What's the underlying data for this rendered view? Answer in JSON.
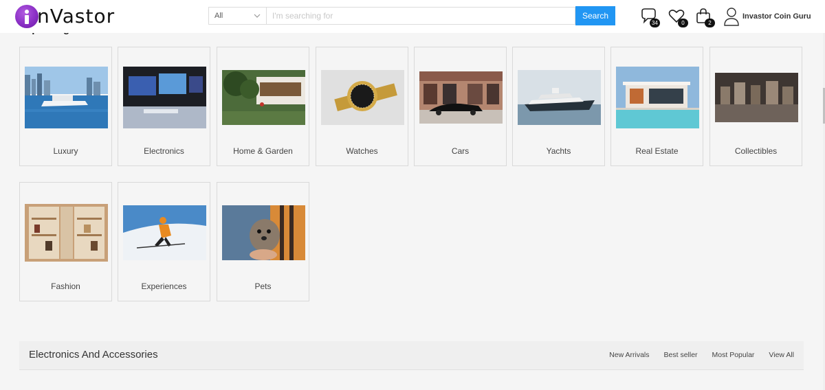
{
  "header": {
    "logo_text": "nVastor",
    "search": {
      "category": "All",
      "placeholder": "I'm searching for",
      "button": "Search"
    },
    "icons": {
      "messages_count": "34",
      "wishlist_count": "0",
      "cart_count": "2"
    },
    "user_name": "Invastor Coin Guru"
  },
  "section": {
    "title": "Top Categories Of The Month"
  },
  "categories": [
    {
      "label": "Luxury"
    },
    {
      "label": "Electronics"
    },
    {
      "label": "Home & Garden"
    },
    {
      "label": "Watches"
    },
    {
      "label": "Cars"
    },
    {
      "label": "Yachts"
    },
    {
      "label": "Real Estate"
    },
    {
      "label": "Collectibles"
    },
    {
      "label": "Fashion"
    },
    {
      "label": "Experiences"
    },
    {
      "label": "Pets"
    }
  ],
  "bottom": {
    "title": "Electronics And Accessories",
    "links": [
      "New Arrivals",
      "Best seller",
      "Most Popular",
      "View All"
    ]
  },
  "colors": {
    "accent": "#2196f3",
    "logo": "#8a2fc5",
    "background": "#f5f5f5"
  }
}
